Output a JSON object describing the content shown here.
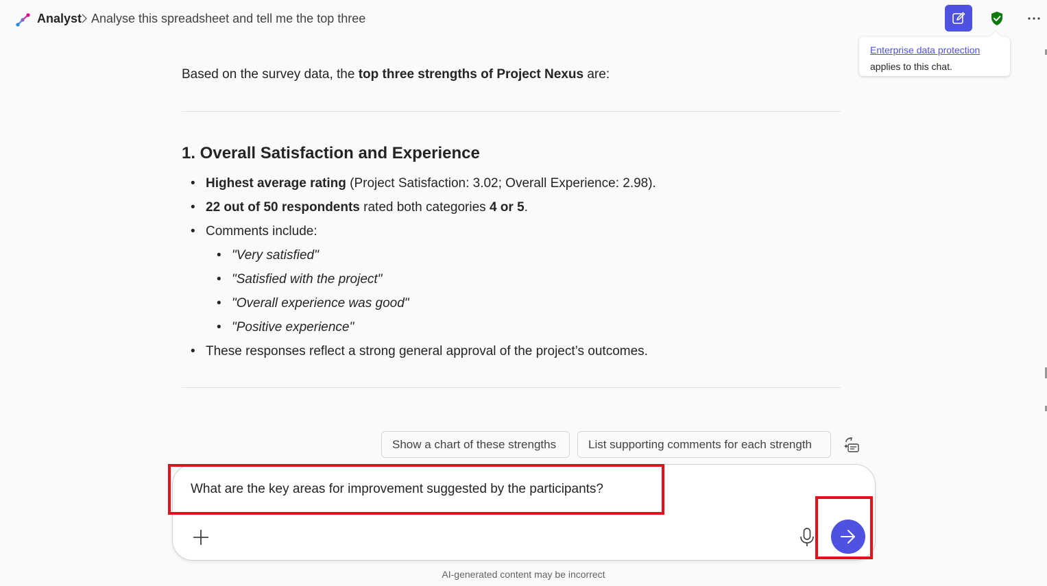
{
  "header": {
    "app_name": "Analyst",
    "chat_title": "Analyse this spreadsheet and tell me the top three",
    "icons": [
      "analyst-logo-icon",
      "chevron-right-icon",
      "new-chat-icon",
      "shield-check-icon",
      "more-icon"
    ]
  },
  "tooltip": {
    "link": "Enterprise data protection",
    "text": "applies to this chat."
  },
  "response": {
    "intro_prefix": "Based on the survey data, the ",
    "intro_bold": "top three strengths of Project Nexus",
    "intro_suffix": " are:",
    "section_title": "1. Overall Satisfaction and Experience",
    "bullet1_bold": "Highest average rating",
    "bullet1_rest": " (Project Satisfaction: 3.02; Overall Experience: 2.98).",
    "bullet2_bold": "22 out of 50 respondents",
    "bullet2_mid": " rated both categories ",
    "bullet2_bold2": "4 or 5",
    "bullet2_end": ".",
    "bullet3": "Comments include:",
    "comments": [
      "\"Very satisfied\"",
      "\"Satisfied with the project\"",
      "\"Overall experience was good\"",
      "\"Positive experience\""
    ],
    "bullet4": "These responses reflect a strong general approval of the project’s outcomes."
  },
  "suggestions": [
    "Show a chart of these strengths",
    "List supporting comments for each strength"
  ],
  "composer": {
    "input_value": "What are the key areas for improvement suggested by the participants?"
  },
  "disclaimer": "AI-generated content may be incorrect",
  "colors": {
    "accent": "#4f52e0",
    "shield": "#0e7a0d",
    "highlight": "#e2121c",
    "background": "#fafafa"
  }
}
